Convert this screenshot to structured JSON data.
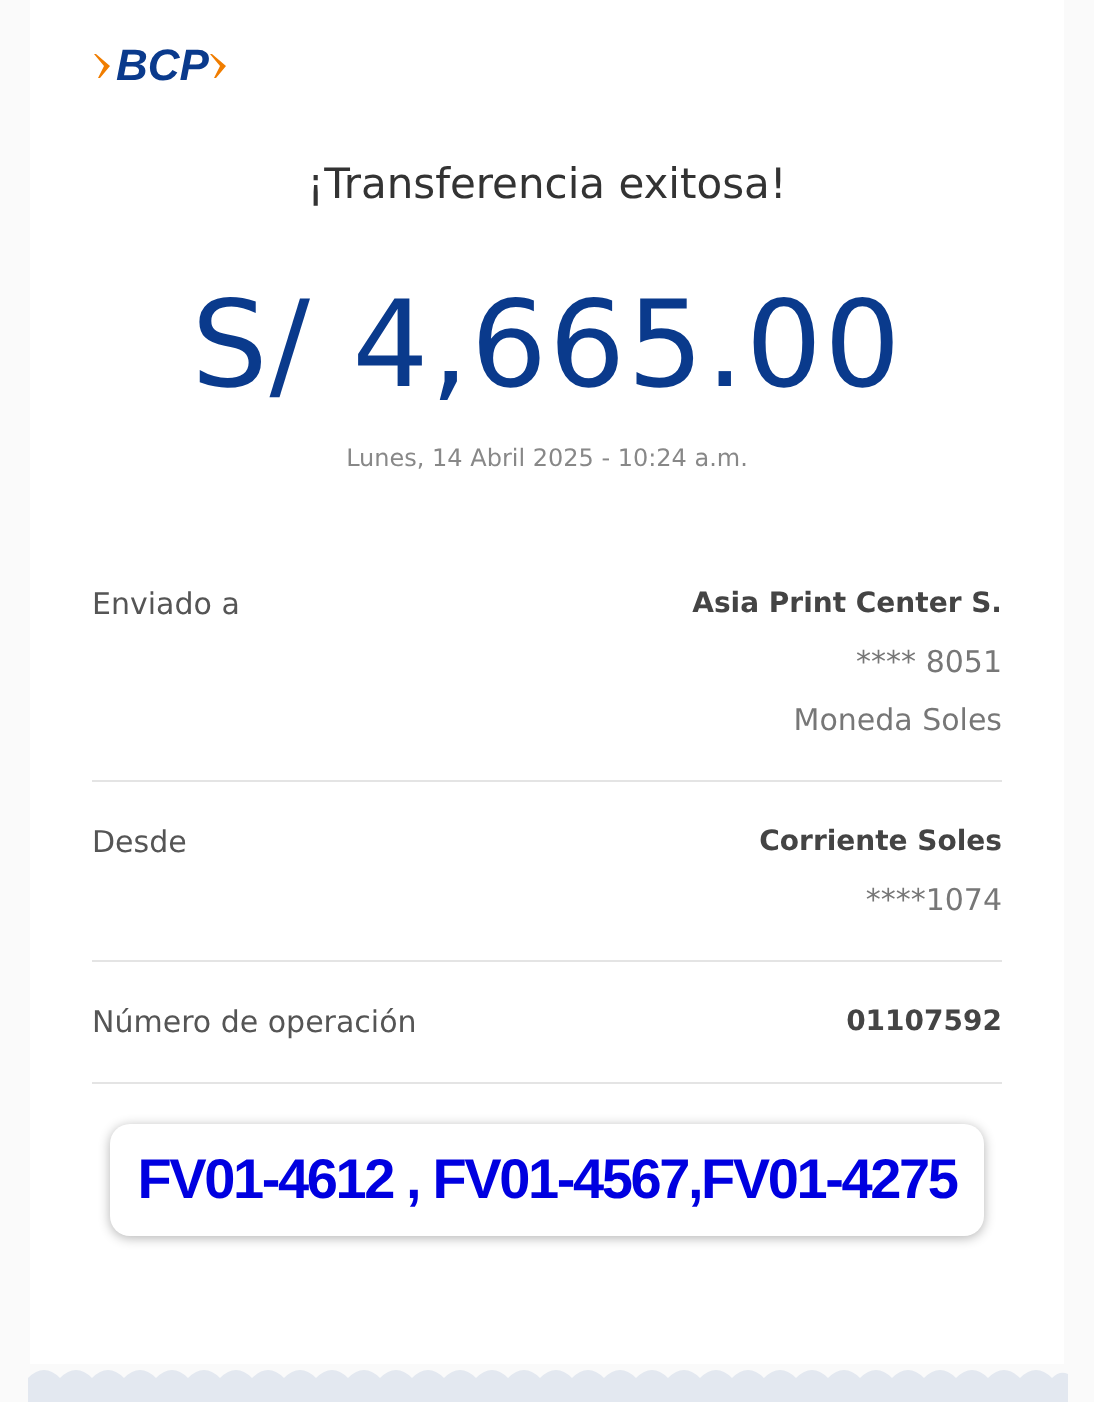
{
  "logo": {
    "text": "BCP"
  },
  "title": "¡Transferencia exitosa!",
  "amount": "S/ 4,665.00",
  "datetime": "Lunes, 14 Abril 2025 - 10:24 a.m.",
  "details": [
    {
      "label": "Enviado a",
      "values": [
        {
          "text": "Asia Print Center S.",
          "bold": true
        },
        {
          "text": "**** 8051",
          "bold": false
        },
        {
          "text": "Moneda Soles",
          "bold": false
        }
      ]
    },
    {
      "label": "Desde",
      "values": [
        {
          "text": "Corriente Soles",
          "bold": true
        },
        {
          "text": "****1074",
          "bold": false
        }
      ]
    },
    {
      "label": "Número de operación",
      "values": [
        {
          "text": "01107592",
          "bold": true
        }
      ]
    }
  ],
  "note": "FV01-4612 , FV01-4567,FV01-4275"
}
